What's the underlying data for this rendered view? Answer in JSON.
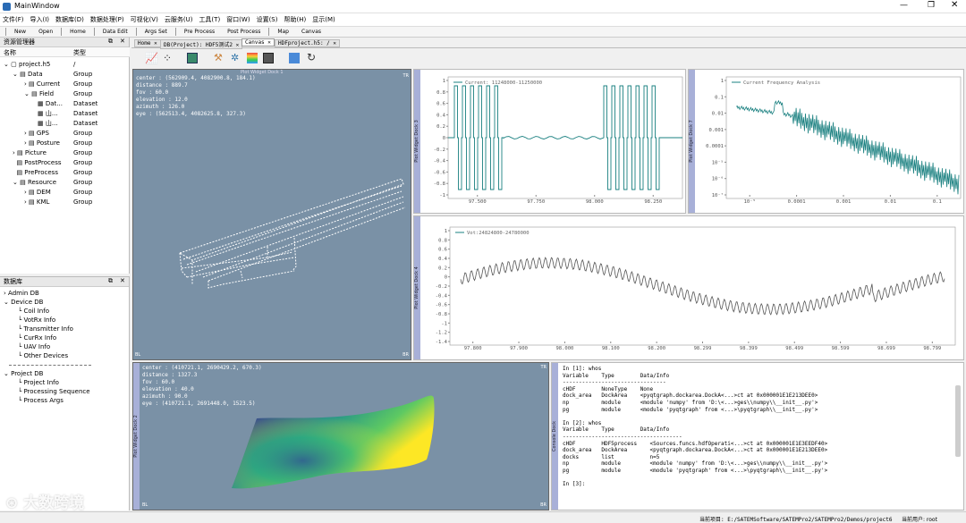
{
  "window": {
    "title": "MainWindow"
  },
  "menu": [
    "文件(F)",
    "导入(I)",
    "数据库(D)",
    "数据处理(P)",
    "可视化(V)",
    "云服务(U)",
    "工具(T)",
    "窗口(W)",
    "设置(S)",
    "帮助(H)",
    "显示(M)"
  ],
  "toolbar": [
    "New",
    "Open",
    "Home",
    "Data Edit",
    "Args Set",
    "Pre Process",
    "Post Process",
    "Map",
    "Canvas"
  ],
  "resource": {
    "title": "资源管理器",
    "col_name": "名称",
    "col_type": "类型",
    "rows": [
      {
        "label": "project.h5",
        "type": "/"
      },
      {
        "label": "Data",
        "type": "Group"
      },
      {
        "label": "Current",
        "type": "Group"
      },
      {
        "label": "Field",
        "type": "Group"
      },
      {
        "label": "Dat...",
        "type": "Dataset"
      },
      {
        "label": "山...",
        "type": "Dataset"
      },
      {
        "label": "山...",
        "type": "Dataset"
      },
      {
        "label": "GPS",
        "type": "Group"
      },
      {
        "label": "Posture",
        "type": "Group"
      },
      {
        "label": "Picture",
        "type": "Group"
      },
      {
        "label": "PostProcess",
        "type": "Group"
      },
      {
        "label": "PreProcess",
        "type": "Group"
      },
      {
        "label": "Resource",
        "type": "Group"
      },
      {
        "label": "DEM",
        "type": "Group"
      },
      {
        "label": "KML",
        "type": "Group"
      }
    ]
  },
  "database": {
    "title": "数据库",
    "items": [
      "Admin DB",
      "Device DB",
      "Coil Info",
      "VotRx Info",
      "Transmitter Info",
      "CurRx Info",
      "UAV Info",
      "Other Devices",
      "Project DB",
      "Project Info",
      "Processing Sequence",
      "Process Args"
    ]
  },
  "tabs": [
    "Home",
    "DB(Project): HDF5测试2",
    "Canvas",
    "HDFproject.h5: /"
  ],
  "views": {
    "canvas3d_top": {
      "title": "Plot Widget Dock 1",
      "overlay": "center : (562909.4, 4082900.8, 184.1)\ndistance : 889.7\nfov : 60.0\nelevation : 12.0\nazimuth : 126.0\neye : (562513.4, 4082625.8, 327.3)",
      "corner": "TR",
      "corner2": "BL",
      "corner3": "BR"
    },
    "canvas3d_bottom": {
      "title": "Plot Widget Dock 2",
      "overlay": "center : (410721.1, 2690429.2, 670.3)\ndistance : 1327.3\nfov : 60.0\nelevation : 40.0\nazimuth : 90.0\neye : (410721.1, 2691448.0, 1523.5)",
      "corner": "TR",
      "corner2": "BL",
      "corner3": "BR"
    },
    "current": {
      "dock": "Plot Widget Dock 3",
      "legend": "Current: 11248000-11250000",
      "yticks": [
        "1",
        "0.8",
        "0.6",
        "0.4",
        "0.2",
        "0",
        "-0.2",
        "-0.4",
        "-0.6",
        "-0.8",
        "-1"
      ],
      "xticks": [
        "97.500",
        "97.750",
        "98.000",
        "98.250"
      ]
    },
    "freq": {
      "dock": "Plot Widget Dock 7",
      "legend": "Current Frequency Analysis",
      "yticks": [
        "1",
        "0.1",
        "0.01",
        "0.001",
        "0.0001",
        "10⁻⁵",
        "10⁻⁶",
        "10⁻⁷"
      ],
      "xticks": [
        "10⁻⁵",
        "0.0001",
        "0.001",
        "0.01",
        "0.1"
      ]
    },
    "vot": {
      "dock": "Plot Widget Dock 4",
      "legend": "Vot:24824800-24780000",
      "yticks": [
        "1",
        "0.8",
        "0.6",
        "0.4",
        "0.2",
        "0",
        "-0.2",
        "-0.4",
        "-0.6",
        "-0.8",
        "-1",
        "-1.2",
        "-1.4"
      ],
      "xticks": [
        "97.800",
        "97.900",
        "98.000",
        "98.100",
        "98.200",
        "98.299",
        "98.399",
        "98.499",
        "98.599",
        "98.699",
        "98.799"
      ]
    },
    "console": {
      "dock": "Console Dock",
      "text": "In [1]: whos\nVariable    Type        Data/Info\n--------------------------------\ncHDF        NoneType    None\ndock_area   DockArea    <pyqtgraph.dockarea.DockA<...>ct at 0x000001E1E213DEE0>\nnp          module      <module 'numpy' from 'D:\\<...>ges\\\\numpy\\\\__init__.py'>\npg          module      <module 'pyqtgraph' from <...>\\pyqtgraph\\\\__init__.py'>\n\nIn [2]: whos\nVariable    Type        Data/Info\n-------------------------------------\ncHDF        HDF5process    <Sources.funcs.hdfOperati<...>ct at 0x000001E1E3EEDF40>\ndock_area   DockArea       <pyqtgraph.dockarea.DockA<...>ct at 0x000001E1E213DEE0>\ndocks       list           n=5\nnp          module         <module 'numpy' from 'D:\\<...>ges\\\\numpy\\\\__init__.py'>\npg          module         <module 'pyqtgraph' from <...>\\pyqtgraph\\\\__init__.py'>\n\nIn [3]:"
    }
  },
  "status": {
    "project": "当前项目: E:/SATEMSoftware/SATEMPro2/SATEMPro2/Demos/project6",
    "user": "当前用户: root"
  },
  "watermark": "大数跨境",
  "colors": {
    "plot_bg": "#7a91a6",
    "dock_bar": "#a8b0d8",
    "series": "#1a8080",
    "vot": "#555555"
  }
}
